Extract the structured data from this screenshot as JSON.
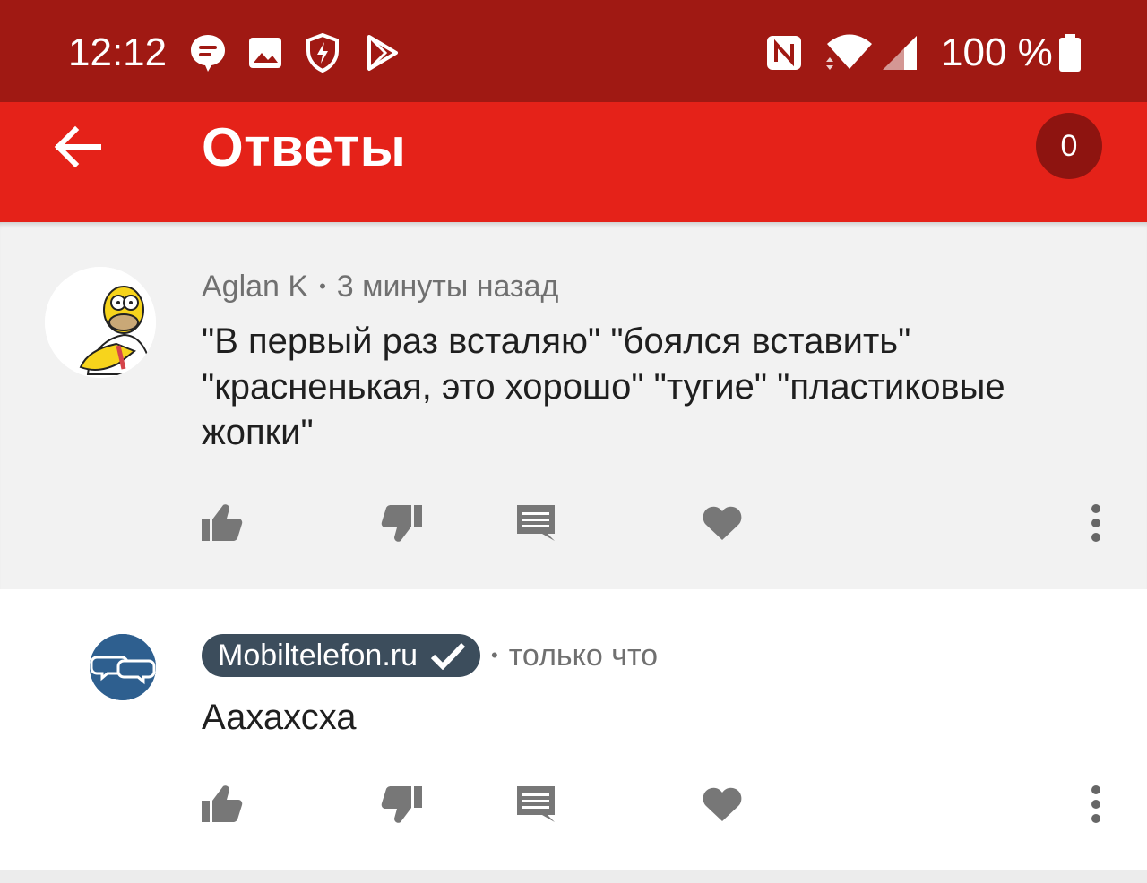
{
  "status_bar": {
    "time": "12:12",
    "battery": "100 %",
    "icons": [
      "chat-bubble-icon",
      "image-icon",
      "shield-bolt-icon",
      "play-store-icon",
      "nfc-icon",
      "wifi-icon",
      "signal-icon",
      "battery-icon"
    ]
  },
  "app_bar": {
    "title": "Ответы",
    "count": "0",
    "color": "#e52219",
    "status_color": "#a01913"
  },
  "comments": [
    {
      "author": "Aglan K",
      "time": "3 минуты назад",
      "text": "\"В первый раз всталяю\" \"боялся вставить\" \"красненькая, это хорошо\" \"тугие\" \"пластиковые жопки\"",
      "avatar": "homer-avatar"
    },
    {
      "author": "Mobiltelefon.ru",
      "verified": true,
      "time": "только что",
      "text": "Аахахсха",
      "avatar": "chat-bubbles-avatar"
    }
  ],
  "actions": [
    "like",
    "dislike",
    "reply",
    "heart",
    "more"
  ]
}
